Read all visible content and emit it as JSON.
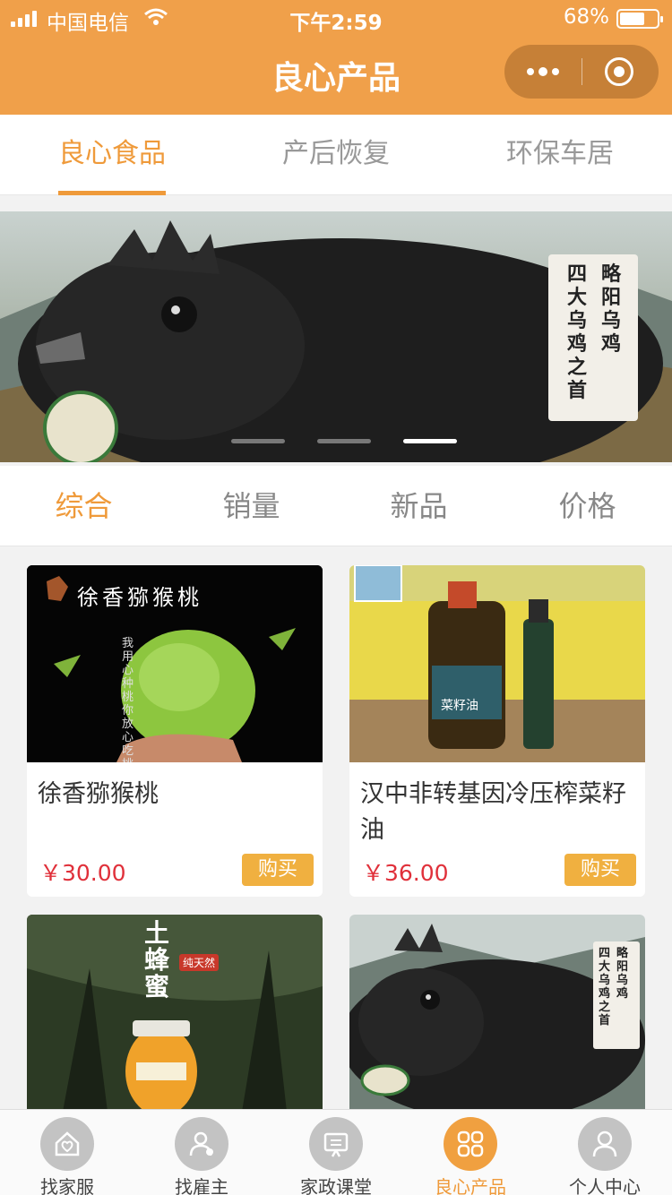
{
  "status_bar": {
    "carrier": "中国电信",
    "time": "下午2:59",
    "battery_text": "68%",
    "battery_level": 0.68
  },
  "nav": {
    "title": "良心产品"
  },
  "tabs": [
    {
      "label": "良心食品",
      "active": true
    },
    {
      "label": "产后恢复",
      "active": false
    },
    {
      "label": "环保车居",
      "active": false
    }
  ],
  "banner": {
    "vertical_text_line1": "略阳乌鸡",
    "vertical_text_line2": "四大乌鸡之首",
    "slide_count": 3,
    "active_slide": 3
  },
  "sort_options": [
    {
      "label": "综合",
      "active": true
    },
    {
      "label": "销量",
      "active": false
    },
    {
      "label": "新品",
      "active": false
    },
    {
      "label": "价格",
      "active": false
    }
  ],
  "products": [
    {
      "name": "徐香猕猴桃",
      "price": "￥30.00",
      "buy_label": "购买",
      "image_title": "徐香猕猴桃",
      "image_side_text": "我用心种桃 你放心吃桃"
    },
    {
      "name": "汉中非转基因冷压榨菜籽油",
      "price": "￥36.00",
      "buy_label": "购买",
      "image_label": "菜籽油"
    },
    {
      "name": "",
      "price": "",
      "buy_label": "",
      "image_title": "土蜂蜜",
      "image_badge": "纯天然"
    },
    {
      "name": "",
      "price": "",
      "buy_label": "",
      "image_text_line1": "略阳乌鸡",
      "image_text_line2": "四大乌鸡之首"
    }
  ],
  "tabbar": [
    {
      "label": "找家服",
      "icon": "home-heart-icon",
      "active": false
    },
    {
      "label": "找雇主",
      "icon": "user-badge-icon",
      "active": false
    },
    {
      "label": "家政课堂",
      "icon": "classroom-board-icon",
      "active": false
    },
    {
      "label": "良心产品",
      "icon": "grid-squares-icon",
      "active": true
    },
    {
      "label": "个人中心",
      "icon": "user-icon",
      "active": false
    }
  ],
  "colors": {
    "accent": "#ef9a3a",
    "header_bg": "#f0a04a",
    "price": "#e0303a",
    "buy_button": "#f0b040"
  }
}
